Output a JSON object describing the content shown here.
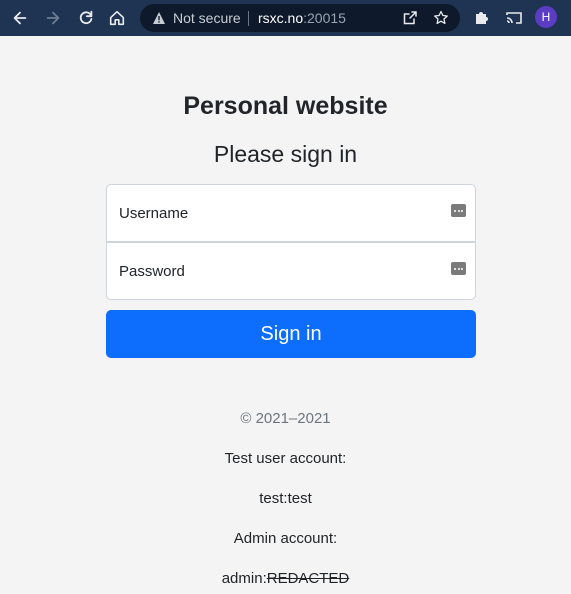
{
  "browser": {
    "security_label": "Not secure",
    "url_host": "rsxc.no",
    "url_port": ":20015",
    "profile_initial": "H"
  },
  "colors": {
    "chrome_bg": "#1f3352",
    "primary_button": "#0d6efd",
    "page_bg": "#f4f4f4"
  },
  "page": {
    "title": "Personal website",
    "heading": "Please sign in",
    "username_placeholder": "Username",
    "password_placeholder": "Password",
    "signin_label": "Sign in"
  },
  "footer": {
    "copyright": "© 2021–2021",
    "test_account_label": "Test user account:",
    "test_account_value": "test:test",
    "admin_account_label": "Admin account:",
    "admin_prefix": "admin:",
    "admin_redacted": "REDACTED"
  }
}
